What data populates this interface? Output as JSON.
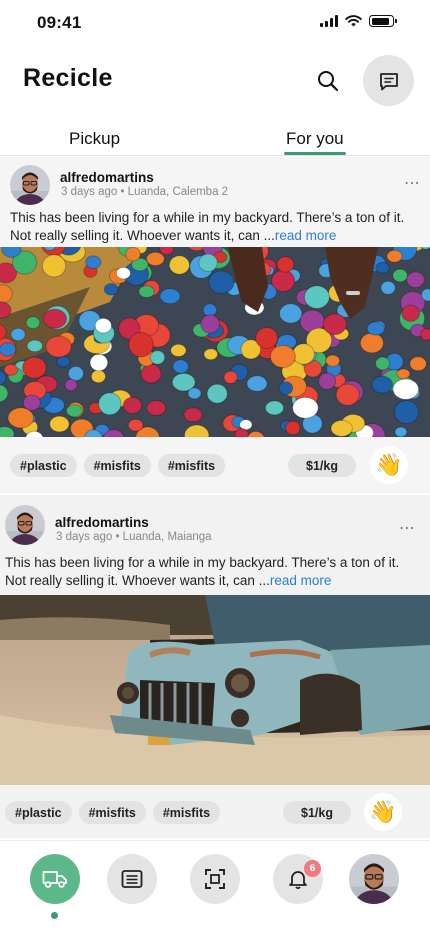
{
  "status_bar": {
    "time": "09:41"
  },
  "header": {
    "title": "Recicle"
  },
  "tabs": [
    {
      "label": "Pickup",
      "active": false
    },
    {
      "label": "For you",
      "active": true
    }
  ],
  "posts": [
    {
      "username": "alfredomartins",
      "meta": "3 days ago • Luanda, Calemba 2",
      "text": "This has been living for a while in my backyard. There’s a ton of it. Not really selling it. Whoever wants it, can ...",
      "read_more": "read more",
      "image": "plastic-bottle-caps-photo",
      "tags": [
        "#plastic",
        "#misfits",
        "#misfits"
      ],
      "price": "$1/kg",
      "reaction": "👋"
    },
    {
      "username": "alfredomartins",
      "meta": "3 days ago • Luanda,  Maianga",
      "text": "This has been living for a while in my backyard. There’s a ton of it. Not really selling it. Whoever wants it, can ...",
      "read_more": "read more",
      "image": "rusty-abandoned-car-photo",
      "tags": [
        "#plastic",
        "#misfits",
        "#misfits"
      ],
      "price": "$1/kg",
      "reaction": "👋"
    }
  ],
  "bottom_nav": {
    "items": [
      "truck-icon",
      "list-icon",
      "scan-icon",
      "bell-icon",
      "profile-avatar"
    ],
    "active_index": 0,
    "notification_count": "6"
  },
  "colors": {
    "accent": "#5cb88a",
    "accent_dark": "#3c9b7a",
    "link": "#2b7fd4",
    "badge": "#f07a82"
  }
}
